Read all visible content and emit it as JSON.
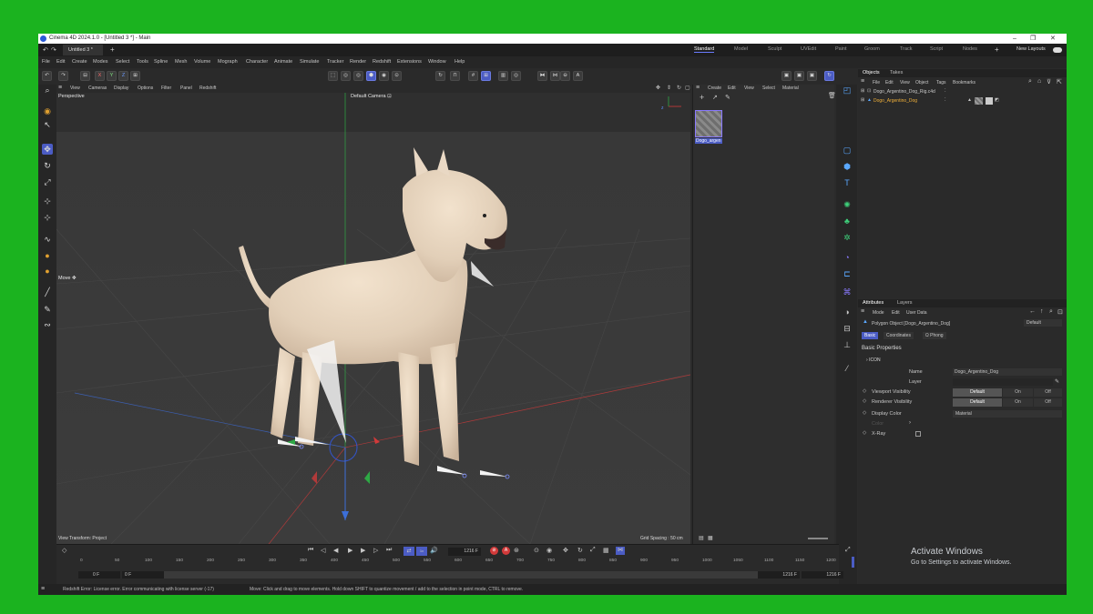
{
  "window": {
    "title": "Cinema 4D 2024.1.0 - [Untitled 3 *] - Main",
    "controls": [
      "–",
      "❐",
      "✕"
    ]
  },
  "tabs": {
    "doc_tab": "Untitled 3 *",
    "layouts": [
      "Standard",
      "Model",
      "Sculpt",
      "UVEdit",
      "Paint",
      "Groom",
      "Track",
      "Script",
      "Nodes"
    ],
    "active_layout": "Standard",
    "new_layouts": "New Layouts"
  },
  "menu": [
    "File",
    "Edit",
    "Create",
    "Modes",
    "Select",
    "Tools",
    "Spline",
    "Mesh",
    "Volume",
    "Mograph",
    "Character",
    "Animate",
    "Simulate",
    "Tracker",
    "Render",
    "Redshift",
    "Extensions",
    "Window",
    "Help"
  ],
  "toolbar": {
    "axis_labels": [
      "X",
      "Y",
      "Z"
    ]
  },
  "viewport": {
    "menu": [
      "View",
      "Cameras",
      "Display",
      "Options",
      "Filter",
      "Panel",
      "Redshift"
    ],
    "label": "Perspective",
    "camera": "Default Camera",
    "camera_icon": "⊡",
    "move_label": "Move",
    "status_left": "View Transform: Project",
    "status_right": "Grid Spacing : 50 cm",
    "axis_z": "z"
  },
  "material_manager": {
    "menu": [
      "Create",
      "Edit",
      "View",
      "Select",
      "Material"
    ],
    "material_name": "Dogo_argen"
  },
  "objects_panel": {
    "tabs": [
      "Objects",
      "Takes"
    ],
    "active_tab": "Objects",
    "menu": [
      "File",
      "Edit",
      "View",
      "Object",
      "Tags",
      "Bookmarks"
    ],
    "items": [
      {
        "name": "Dogo_Argentino_Dog_Rig.c4d"
      },
      {
        "name": "Dogo_Argentino_Dog"
      }
    ]
  },
  "attributes_panel": {
    "tabs": [
      "Attributes",
      "Layers"
    ],
    "active_tab": "Attributes",
    "menu": [
      "Mode",
      "Edit",
      "User Data"
    ],
    "object_title": "Polygon Object [Dogo_Argentino_Dog]",
    "preset": "Default",
    "subtabs": [
      "Basic",
      "Coordinates",
      "Ω Phong"
    ],
    "section": "Basic Properties",
    "icon_label": "ICON",
    "fields": {
      "name_label": "Name",
      "name_value": "Dogo_Argentino_Dog",
      "layer_label": "Layer",
      "viewport_label": "Viewport Visibility",
      "renderer_label": "Renderer Visibility",
      "vis_options": [
        "Default",
        "On",
        "Off"
      ],
      "display_color_label": "Display Color",
      "display_color_value": "Material",
      "color_label": "Color",
      "xray_label": "X-Ray"
    }
  },
  "timeline": {
    "ticks": [
      "0",
      "50",
      "100",
      "150",
      "200",
      "250",
      "300",
      "350",
      "400",
      "450",
      "500",
      "550",
      "600",
      "650",
      "700",
      "750",
      "800",
      "850",
      "900",
      "950",
      "1000",
      "1050",
      "1100",
      "1150",
      "1200"
    ],
    "current_frame": "1216 F",
    "start_frame": "0 F",
    "start_frame2": "0 F",
    "end_frame": "1216 F",
    "end_frame2": "1216 F"
  },
  "statusbar": {
    "error": "Redshift Error: License error. Error communicating with license server (-17)",
    "hint": "Move: Click and drag to move elements. Hold down SHIFT to quantize movement / add to the selection in point mode, CTRL to remove."
  },
  "watermark": {
    "line1": "Activate Windows",
    "line2": "Go to Settings to activate Windows."
  },
  "colors": {
    "accent": "#4b5cc4",
    "background_green": "#1bb31f",
    "panel": "#2a2a2a",
    "dog_fur": "#e8d6c0"
  }
}
